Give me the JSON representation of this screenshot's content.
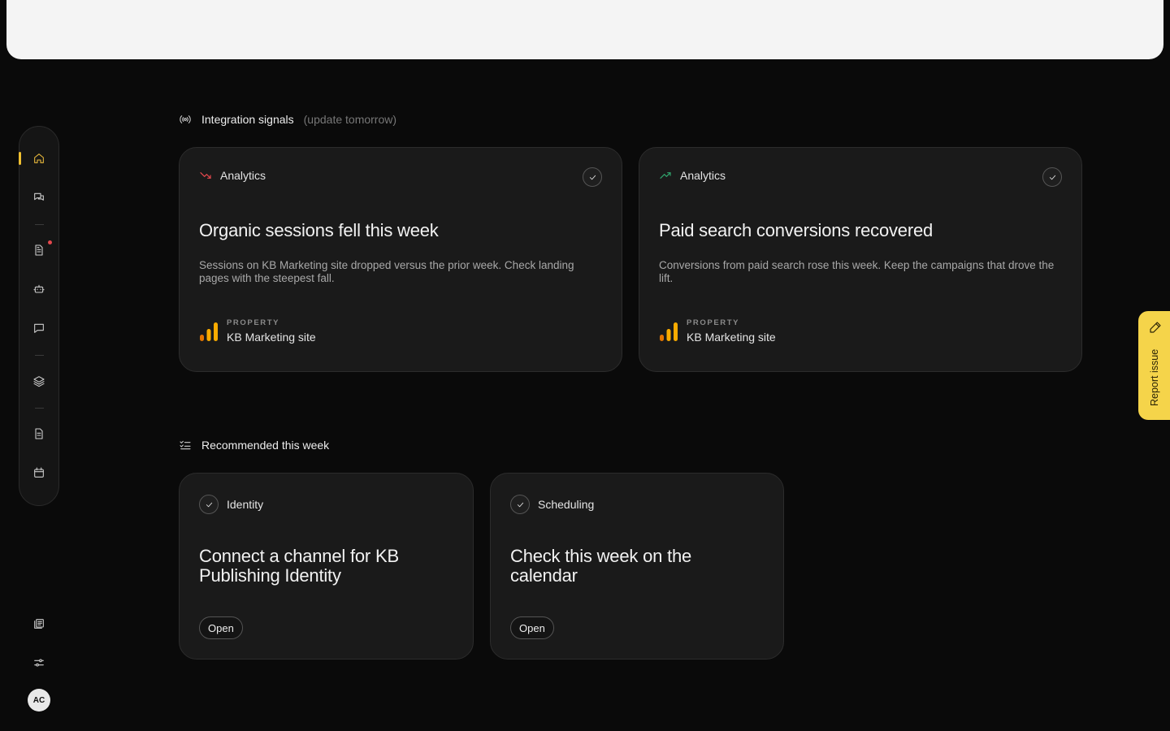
{
  "sidebar": {
    "items": [
      {
        "name": "home"
      },
      {
        "name": "conversations"
      },
      {
        "name": "documents"
      },
      {
        "name": "assistant"
      },
      {
        "name": "messages"
      },
      {
        "name": "layers"
      },
      {
        "name": "reports"
      },
      {
        "name": "calendar"
      }
    ],
    "active": "home",
    "avatar_initials": "AC"
  },
  "integration_signals": {
    "title": "Integration signals",
    "note": "(update tomorrow)",
    "cards": [
      {
        "tag": "Analytics",
        "trend": "down",
        "trend_color": "#e5484d",
        "title": "Organic sessions fell this week",
        "description": "Sessions on KB Marketing site dropped versus the prior week. Check landing pages with the steepest fall.",
        "property_label": "PROPERTY",
        "property_value": "KB Marketing site"
      },
      {
        "tag": "Analytics",
        "trend": "up",
        "trend_color": "#30a46c",
        "title": "Paid search conversions recovered",
        "description": "Conversions from paid search rose this week. Keep the campaigns that drove the lift.",
        "property_label": "PROPERTY",
        "property_value": "KB Marketing site"
      }
    ]
  },
  "recommended": {
    "title": "Recommended this week",
    "cards": [
      {
        "tag": "Identity",
        "title": "Connect a channel for KB Publishing Identity",
        "button": "Open"
      },
      {
        "tag": "Scheduling",
        "title": "Check this week on the calendar",
        "button": "Open"
      }
    ]
  },
  "report_issue": {
    "label": "Report issue"
  },
  "colors": {
    "accent": "#f0c030",
    "analytics_orange": "#f9ab00"
  }
}
